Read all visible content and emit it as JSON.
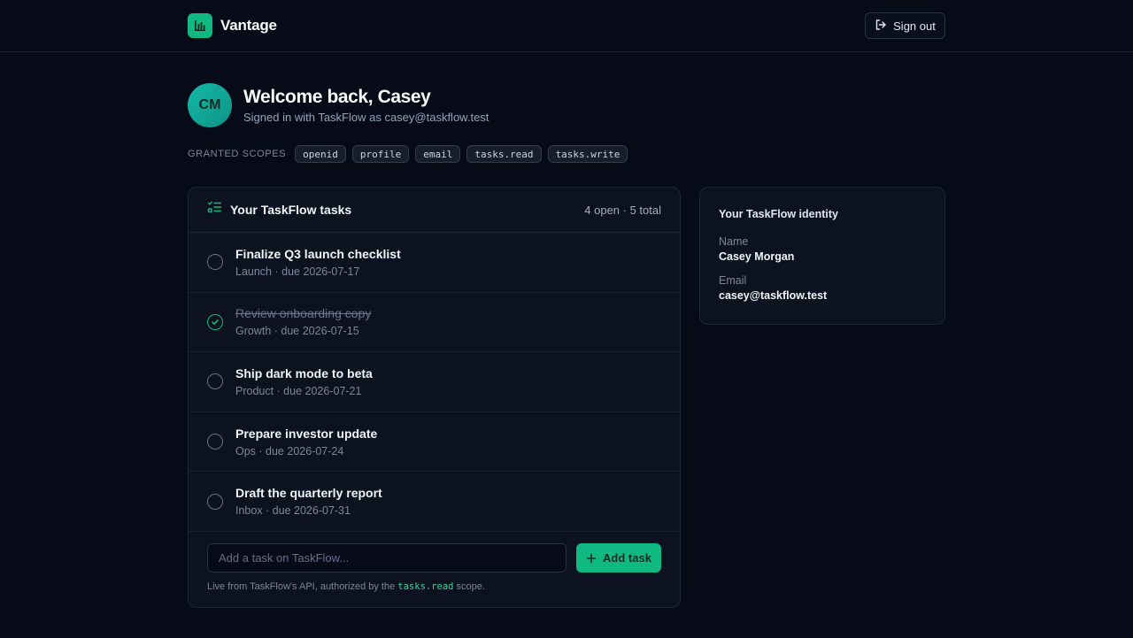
{
  "header": {
    "brand_name": "Vantage",
    "logo_icon": "bar-chart-icon",
    "signout_label": "Sign out",
    "signout_icon": "sign-out-icon"
  },
  "user": {
    "initials": "CM",
    "welcome": "Welcome back, Casey",
    "signed_in_text": "Signed in with TaskFlow as casey@taskflow.test"
  },
  "scopes": {
    "label": "GRANTED SCOPES",
    "items": [
      "openid",
      "profile",
      "email",
      "tasks.read",
      "tasks.write"
    ]
  },
  "tasks": {
    "title": "Your TaskFlow tasks",
    "icon": "task-list-icon",
    "count_text": "4 open · 5 total",
    "items": [
      {
        "title": "Finalize Q3 launch checklist",
        "meta": "Launch · due 2026-07-17",
        "done": false
      },
      {
        "title": "Review onboarding copy",
        "meta": "Growth · due 2026-07-15",
        "done": true
      },
      {
        "title": "Ship dark mode to beta",
        "meta": "Product · due 2026-07-21",
        "done": false
      },
      {
        "title": "Prepare investor update",
        "meta": "Ops · due 2026-07-24",
        "done": false
      },
      {
        "title": "Draft the quarterly report",
        "meta": "Inbox · due 2026-07-31",
        "done": false
      }
    ],
    "add_placeholder": "Add a task on TaskFlow...",
    "add_button_label": "Add task",
    "footnote_before": "Live from TaskFlow's API, authorized by the ",
    "footnote_code": "tasks.read",
    "footnote_after": " scope."
  },
  "identity": {
    "title": "Your TaskFlow identity",
    "name_label": "Name",
    "name_value": "Casey Morgan",
    "email_label": "Email",
    "email_value": "casey@taskflow.test"
  },
  "colors": {
    "accent": "#10b981",
    "background": "#070b17",
    "card": "#0c1220"
  }
}
